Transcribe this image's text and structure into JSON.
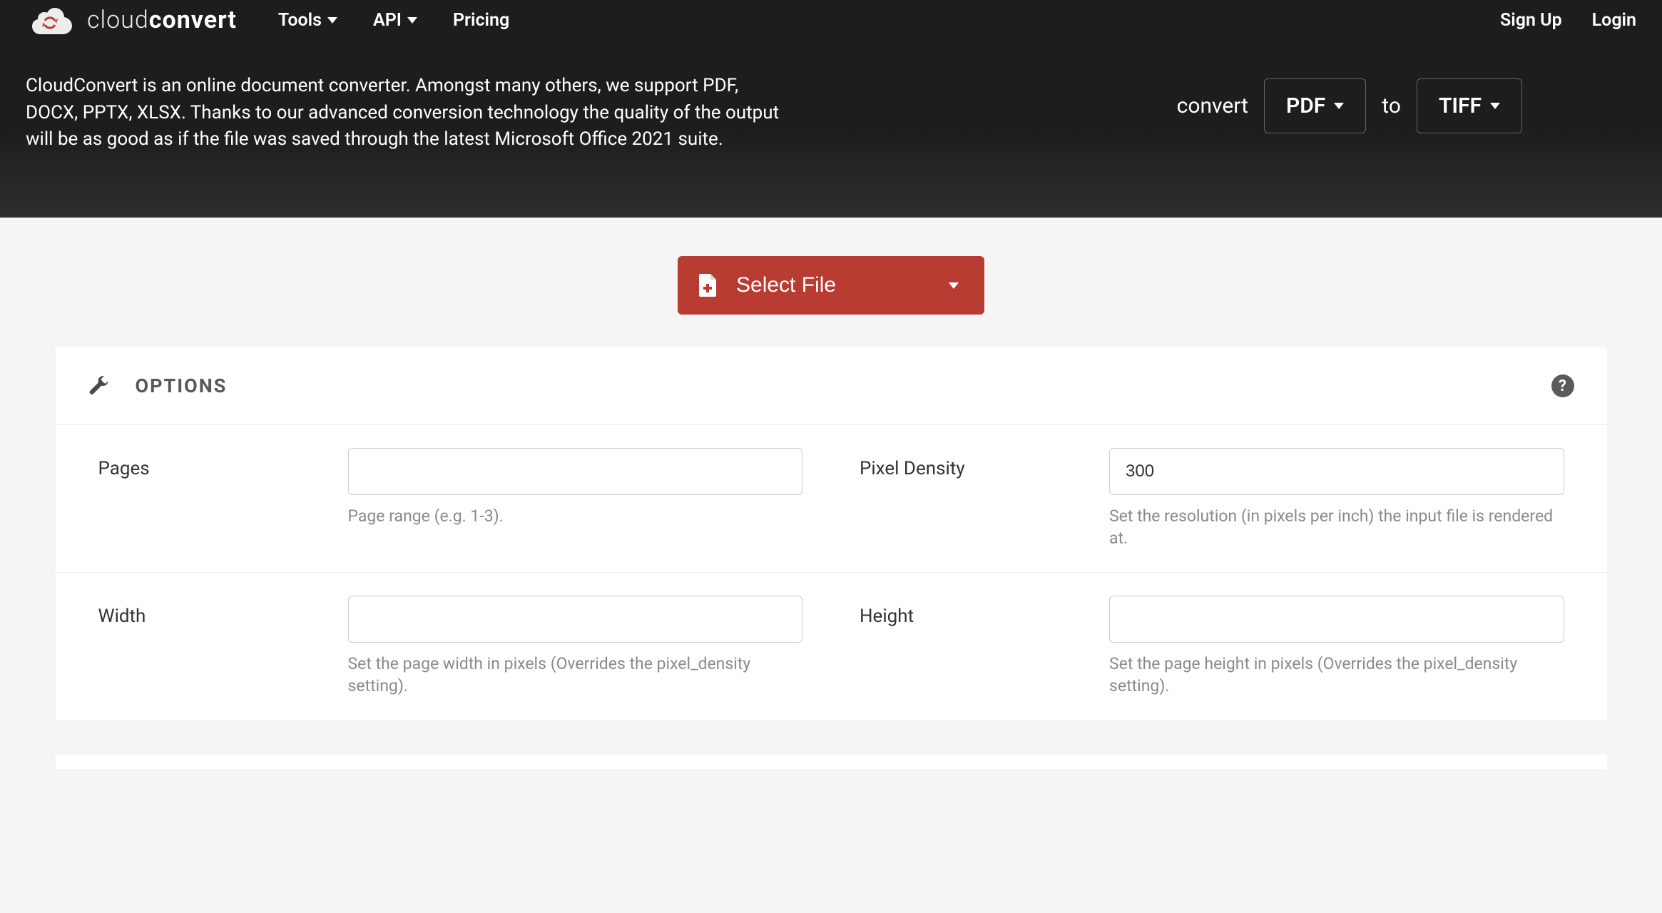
{
  "brand": {
    "light": "cloud",
    "bold": "convert"
  },
  "nav": {
    "tools": "Tools",
    "api": "API",
    "pricing": "Pricing"
  },
  "auth": {
    "signup": "Sign Up",
    "login": "Login"
  },
  "hero": {
    "description": "CloudConvert is an online document converter. Amongst many others, we support PDF, DOCX, PPTX, XLSX. Thanks to our advanced conversion technology the quality of the output will be as good as if the file was saved through the latest Microsoft Office 2021 suite.",
    "convert_label": "convert",
    "to_label": "to",
    "from_format": "PDF",
    "to_format": "TIFF"
  },
  "select_file_label": "Select File",
  "options": {
    "title": "OPTIONS",
    "fields": {
      "pages": {
        "label": "Pages",
        "value": "",
        "help": "Page range (e.g. 1-3)."
      },
      "pixel_density": {
        "label": "Pixel Density",
        "value": "300",
        "help": "Set the resolution (in pixels per inch) the input file is rendered at."
      },
      "width": {
        "label": "Width",
        "value": "",
        "help": "Set the page width in pixels (Overrides the pixel_density setting)."
      },
      "height": {
        "label": "Height",
        "value": "",
        "help": "Set the page height in pixels (Overrides the pixel_density setting)."
      }
    }
  }
}
